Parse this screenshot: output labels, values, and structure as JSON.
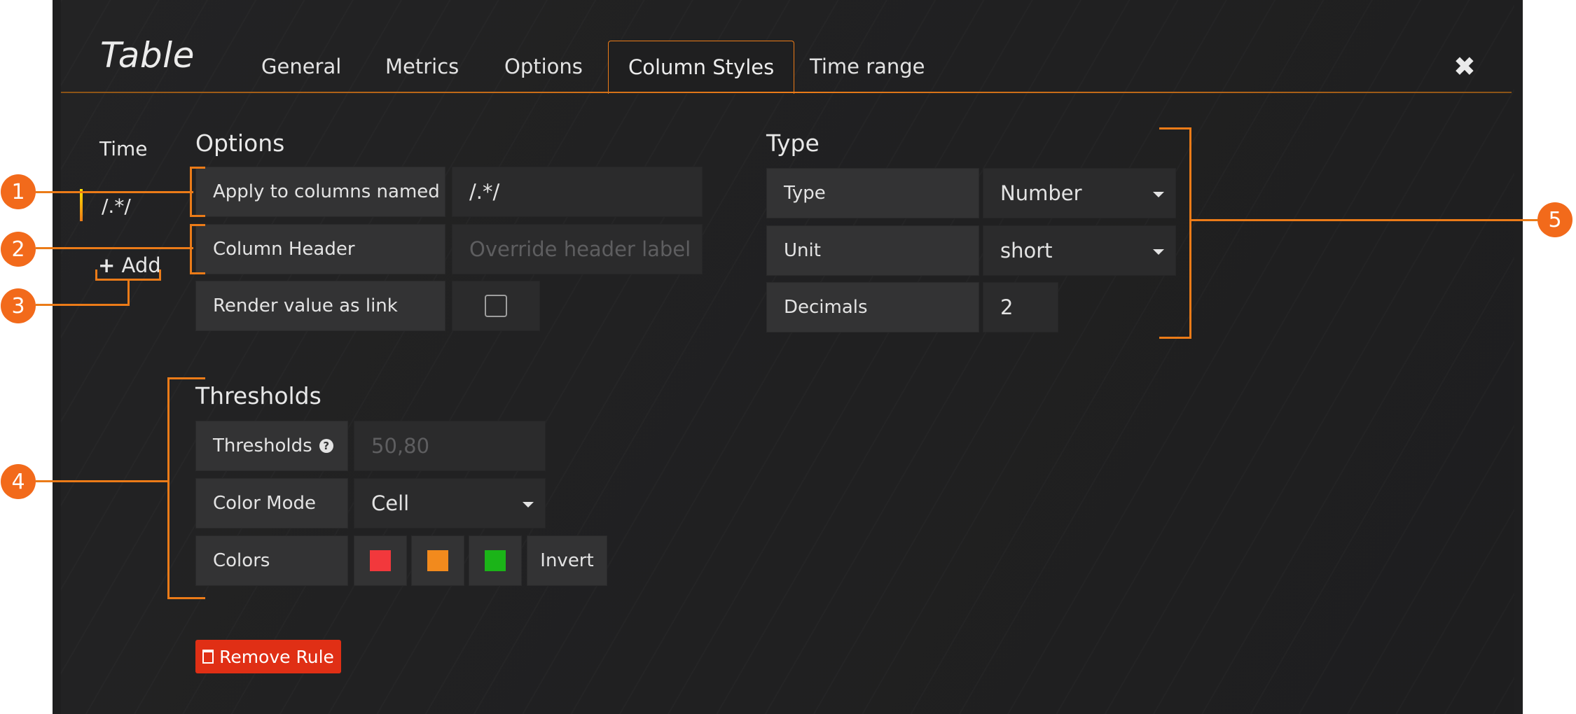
{
  "panel": {
    "title": "Table"
  },
  "tabs": [
    {
      "label": "General"
    },
    {
      "label": "Metrics"
    },
    {
      "label": "Options"
    },
    {
      "label": "Column Styles"
    },
    {
      "label": "Time range"
    }
  ],
  "close_icon": "✖",
  "sidebar": {
    "rules": [
      {
        "label": "Time"
      },
      {
        "label": "/.*/"
      }
    ],
    "add_label": "Add",
    "add_icon": "+"
  },
  "options": {
    "title": "Options",
    "apply_label": "Apply to columns named",
    "apply_value": "/.*/",
    "header_label": "Column Header",
    "header_placeholder": "Override header label",
    "link_label": "Render value as link"
  },
  "type": {
    "title": "Type",
    "type_label": "Type",
    "type_value": "Number",
    "unit_label": "Unit",
    "unit_value": "short",
    "decimals_label": "Decimals",
    "decimals_value": "2"
  },
  "thresholds": {
    "title": "Thresholds",
    "thresholds_label": "Thresholds",
    "thresholds_placeholder": "50,80",
    "help_icon": "?",
    "color_mode_label": "Color Mode",
    "color_mode_value": "Cell",
    "colors_label": "Colors",
    "colors": [
      "#f2383c",
      "#f28a1d",
      "#1bb418"
    ],
    "invert_label": "Invert"
  },
  "remove_rule_label": "Remove Rule",
  "trash_icon": "🗑",
  "callouts": [
    "1",
    "2",
    "3",
    "4",
    "5"
  ]
}
